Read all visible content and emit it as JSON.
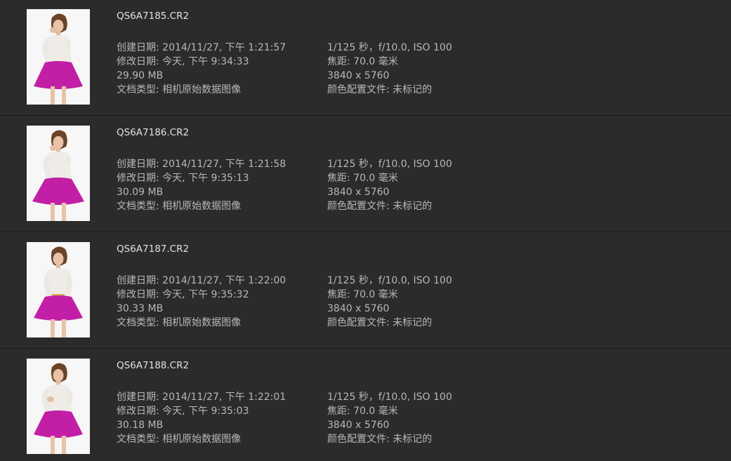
{
  "files": [
    {
      "name": "QS6A7185.CR2",
      "created": "创建日期: 2014/11/27, 下午 1:21:57",
      "modified": "修改日期: 今天, 下午 9:34:33",
      "size": "29.90 MB",
      "kind": "文档类型: 相机原始数据图像",
      "exposure": "1/125 秒，f/10.0, ISO 100",
      "focal": "焦距: 70.0 毫米",
      "dimensions": "3840 x 5760",
      "profile": "颜色配置文件: 未标记的"
    },
    {
      "name": "QS6A7186.CR2",
      "created": "创建日期: 2014/11/27, 下午 1:21:58",
      "modified": "修改日期: 今天, 下午 9:35:13",
      "size": "30.09 MB",
      "kind": "文档类型: 相机原始数据图像",
      "exposure": "1/125 秒，f/10.0, ISO 100",
      "focal": "焦距: 70.0 毫米",
      "dimensions": "3840 x 5760",
      "profile": "颜色配置文件: 未标记的"
    },
    {
      "name": "QS6A7187.CR2",
      "created": "创建日期: 2014/11/27, 下午 1:22:00",
      "modified": "修改日期: 今天, 下午 9:35:32",
      "size": "30.33 MB",
      "kind": "文档类型: 相机原始数据图像",
      "exposure": "1/125 秒，f/10.0, ISO 100",
      "focal": "焦距: 70.0 毫米",
      "dimensions": "3840 x 5760",
      "profile": "颜色配置文件: 未标记的"
    },
    {
      "name": "QS6A7188.CR2",
      "created": "创建日期: 2014/11/27, 下午 1:22:01",
      "modified": "修改日期: 今天, 下午 9:35:03",
      "size": "30.18 MB",
      "kind": "文档类型: 相机原始数据图像",
      "exposure": "1/125 秒，f/10.0, ISO 100",
      "focal": "焦距: 70.0 毫米",
      "dimensions": "3840 x 5760",
      "profile": "颜色配置文件: 未标记的"
    }
  ],
  "colors": {
    "background": "#2b2b2b",
    "filename": "#e2e2e2",
    "meta": "#b8b8b8",
    "skirt": "#c21fa6"
  }
}
